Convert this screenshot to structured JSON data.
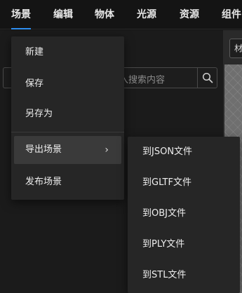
{
  "menubar": {
    "items": [
      {
        "label": "场景",
        "active": true
      },
      {
        "label": "编辑"
      },
      {
        "label": "物体"
      },
      {
        "label": "光源"
      },
      {
        "label": "资源"
      },
      {
        "label": "组件"
      }
    ]
  },
  "search": {
    "placeholder_visible": "入搜索内容",
    "icon": "search-icon"
  },
  "right_panel": {
    "tab_label": "材"
  },
  "dropdown": {
    "items": [
      {
        "label": "新建"
      },
      {
        "label": "保存"
      },
      {
        "label": "另存为"
      },
      {
        "label": "导出场景",
        "has_submenu": true,
        "hovered": true
      },
      {
        "label": "发布场景"
      }
    ]
  },
  "submenu": {
    "items": [
      {
        "label": "到JSON文件"
      },
      {
        "label": "到GLTF文件"
      },
      {
        "label": "到OBJ文件"
      },
      {
        "label": "到PLY文件"
      },
      {
        "label": "到STL文件"
      }
    ]
  },
  "colors": {
    "accent": "#2f8ff0",
    "menu_bg": "#262626",
    "hover_bg": "#3a3a3a",
    "bar_bg": "#141414"
  }
}
